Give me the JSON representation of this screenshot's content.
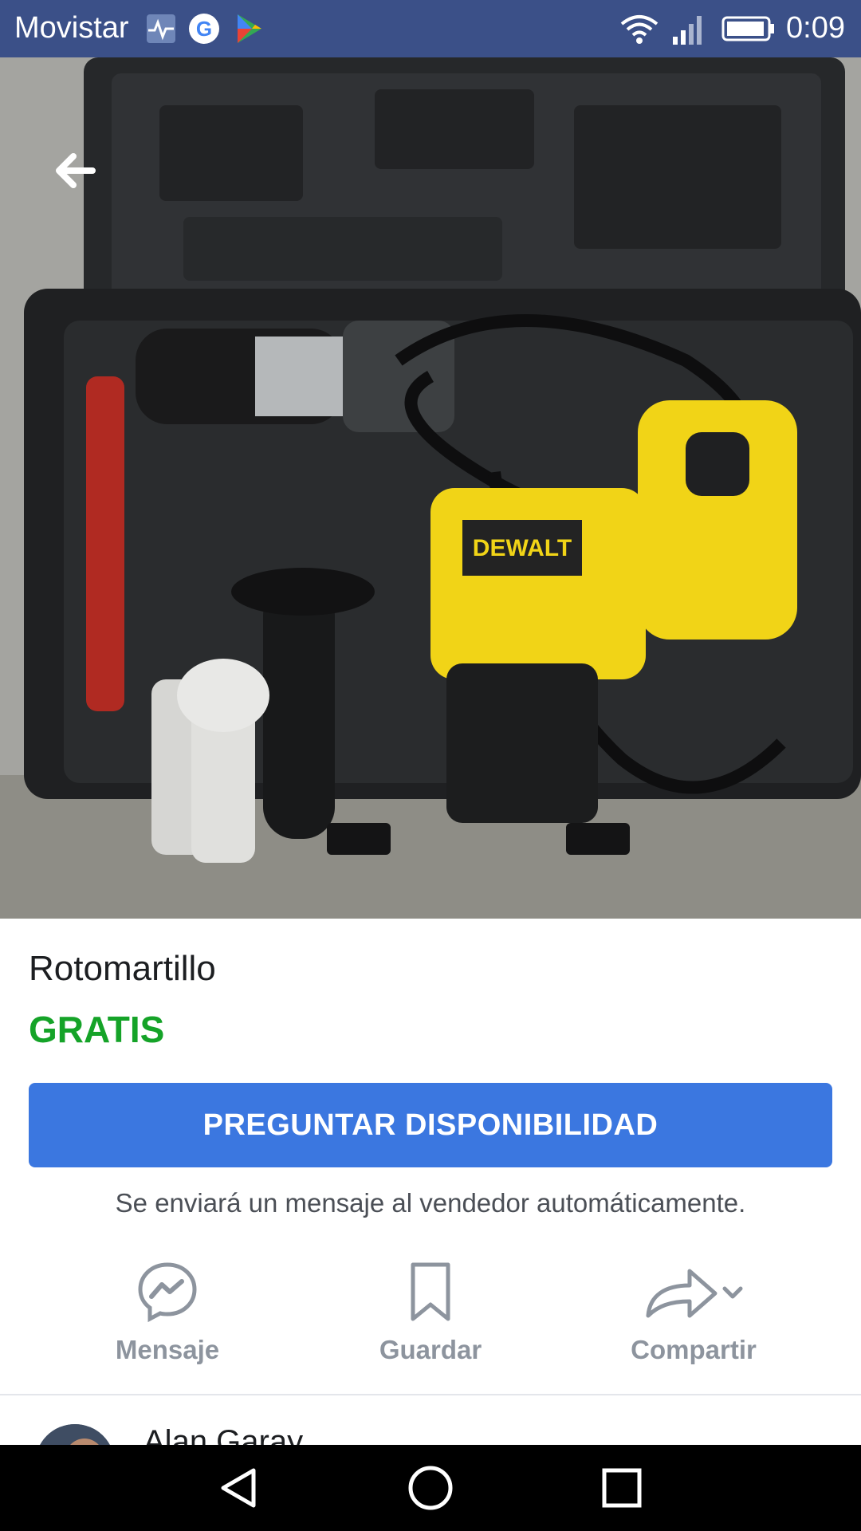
{
  "status_bar": {
    "carrier": "Movistar",
    "time": "0:09",
    "icons": [
      "health-icon",
      "google-icon",
      "play-store-icon",
      "wifi-icon",
      "signal-icon",
      "battery-icon"
    ]
  },
  "product": {
    "title": "Rotomartillo",
    "price": "GRATIS",
    "price_color": "#15a328"
  },
  "ask_button": {
    "label": "PREGUNTAR DISPONIBILIDAD",
    "color": "#3b77e0"
  },
  "helper_text": "Se enviará un mensaje al vendedor automáticamente.",
  "actions": [
    {
      "label": "Mensaje",
      "icon": "messenger-icon"
    },
    {
      "label": "Guardar",
      "icon": "bookmark-icon"
    },
    {
      "label": "Compartir",
      "icon": "share-icon"
    }
  ],
  "seller": {
    "name": "Alan Garay"
  },
  "nav": [
    "back-triangle-icon",
    "home-circle-icon",
    "recents-square-icon"
  ]
}
